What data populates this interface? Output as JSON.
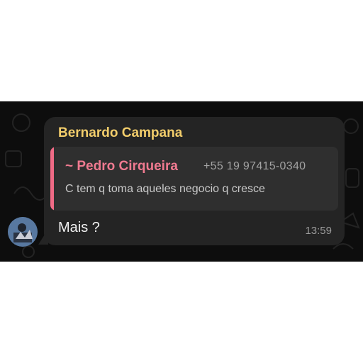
{
  "message": {
    "sender_name": "Bernardo Campana",
    "quoted": {
      "author": "~ Pedro Cirqueira",
      "phone": "+55 19 97415-0340",
      "text": "C tem q toma aqueles negocio q cresce"
    },
    "text": "Mais ?",
    "time": "13:59"
  },
  "colors": {
    "chat_background": "#0d0d0d",
    "bubble": "#242424",
    "sender_name": "#f2cd6b",
    "quote_background": "#2f2f2f",
    "quote_accent": "#f06b86",
    "timestamp": "#9b9b9b"
  }
}
